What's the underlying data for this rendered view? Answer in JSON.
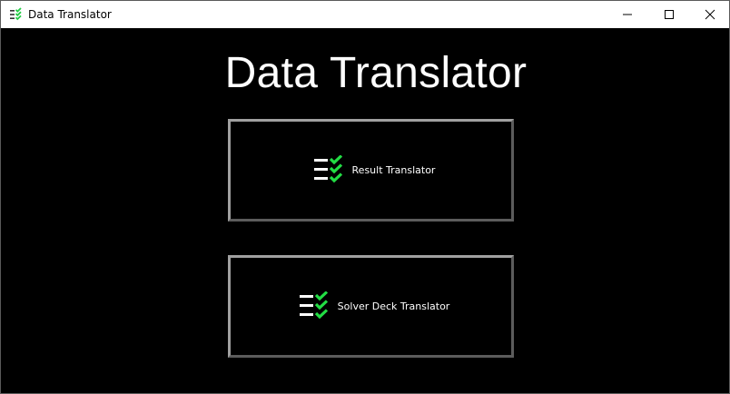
{
  "window": {
    "title": "Data Translator",
    "app_icon": "checklist-icon",
    "controls": {
      "minimize_icon": "minimize-icon",
      "maximize_icon": "maximize-icon",
      "close_icon": "close-icon"
    }
  },
  "main": {
    "heading": "Data Translator",
    "buttons": [
      {
        "label": "Result Translator",
        "icon": "checklist-icon"
      },
      {
        "label": "Solver Deck Translator",
        "icon": "checklist-icon"
      }
    ]
  },
  "colors": {
    "background": "#000000",
    "text": "#ffffff",
    "check_green": "#22dd44",
    "button_border_light": "#a0a0a0",
    "button_border_dark": "#5c5c5c"
  }
}
